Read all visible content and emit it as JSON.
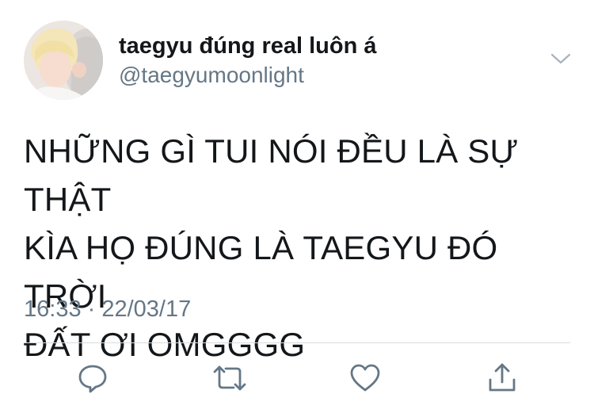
{
  "tweet": {
    "display_name": "taegyu đúng real luôn á",
    "handle": "@taegyumoonlight",
    "text": "NHỮNG GÌ TUI NÓI ĐỀU LÀ SỰ THẬT\nKÌA HỌ ĐÚNG LÀ TAEGYU ĐÓ TRỜI\nĐẤT ƠI OMGGGG",
    "timestamp": "16:33 · 22/03/17"
  },
  "actions": [
    {
      "icon": "reply-icon"
    },
    {
      "icon": "retweet-icon"
    },
    {
      "icon": "like-icon"
    },
    {
      "icon": "share-icon"
    }
  ],
  "colors": {
    "text": "#14171a",
    "secondary": "#657786",
    "divider": "#d7dce0",
    "icon": "#657786"
  }
}
